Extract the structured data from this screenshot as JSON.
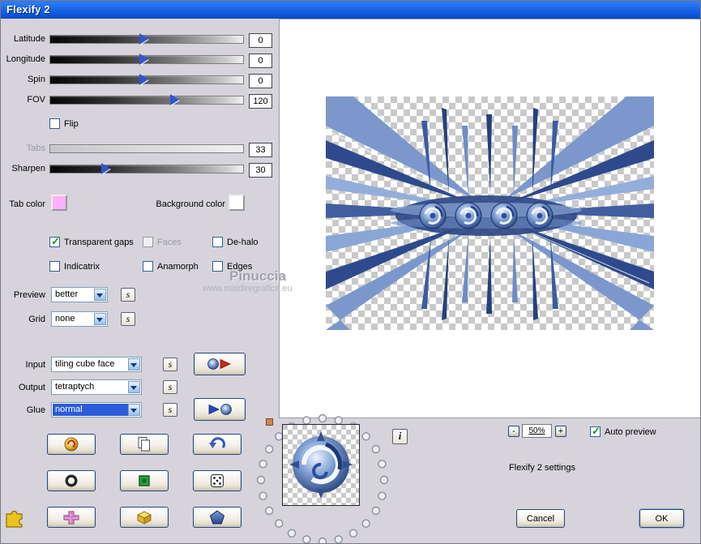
{
  "window": {
    "title": "Flexify 2"
  },
  "sliders": [
    {
      "label": "Latitude",
      "value": "0"
    },
    {
      "label": "Longitude",
      "value": "0"
    },
    {
      "label": "Spin",
      "value": "0"
    },
    {
      "label": "FOV",
      "value": "120"
    },
    {
      "label": "Tabs",
      "value": "33",
      "disabled": true
    },
    {
      "label": "Sharpen",
      "value": "30"
    }
  ],
  "checkboxes": {
    "flip": {
      "label": "Flip",
      "checked": false
    },
    "transparent_gaps": {
      "label": "Transparent gaps",
      "checked": true
    },
    "faces": {
      "label": "Faces",
      "checked": false,
      "disabled": true
    },
    "dehalo": {
      "label": "De-halo",
      "checked": false
    },
    "indicatrix": {
      "label": "Indicatrix",
      "checked": false
    },
    "anamorph": {
      "label": "Anamorph",
      "checked": false
    },
    "edges": {
      "label": "Edges",
      "checked": false
    },
    "auto_preview": {
      "label": "Auto preview",
      "checked": true
    }
  },
  "color_pickers": {
    "tab_color": {
      "label": "Tab color",
      "color": "#ffb0f8"
    },
    "background_color": {
      "label": "Background color",
      "color": "#ffffff"
    }
  },
  "dropdowns": {
    "preview": {
      "label": "Preview",
      "value": "better"
    },
    "grid": {
      "label": "Grid",
      "value": "none"
    },
    "input": {
      "label": "Input",
      "value": "tiling cube face"
    },
    "output": {
      "label": "Output",
      "value": "tetraptych"
    },
    "glue": {
      "label": "Glue",
      "value": "normal",
      "highlighted": true
    }
  },
  "s_button_label": "s",
  "zoom": {
    "minus": "-",
    "value": "50%",
    "plus": "+"
  },
  "info_button_label": "i",
  "settings_text": "Flexify 2 settings",
  "action_buttons": {
    "cancel": "Cancel",
    "ok": "OK"
  },
  "watermark": {
    "line1": "Pinuccia",
    "line2": "www.maidiregrafica.eu"
  },
  "icons": {
    "swirl_ball_icon": "gold sphere with red swirl",
    "copy_icon": "two overlapping pages",
    "undo_icon": "blue curved arrow",
    "ring_icon": "dark ring",
    "green_square_icon": "green framed square",
    "dice_icon": "white die with dots",
    "cross_icon": "pink cross",
    "box_icon": "yellow cube",
    "pentagon_icon": "blue pentagon",
    "puzzle_icon": "yellow puzzle piece",
    "render_sphere_play_icon": "sphere with red play arrow",
    "render_play_sphere_icon": "blue play arrow with sphere",
    "info_icon": "letter i",
    "combo_arrow_icon": "dropdown arrow"
  }
}
